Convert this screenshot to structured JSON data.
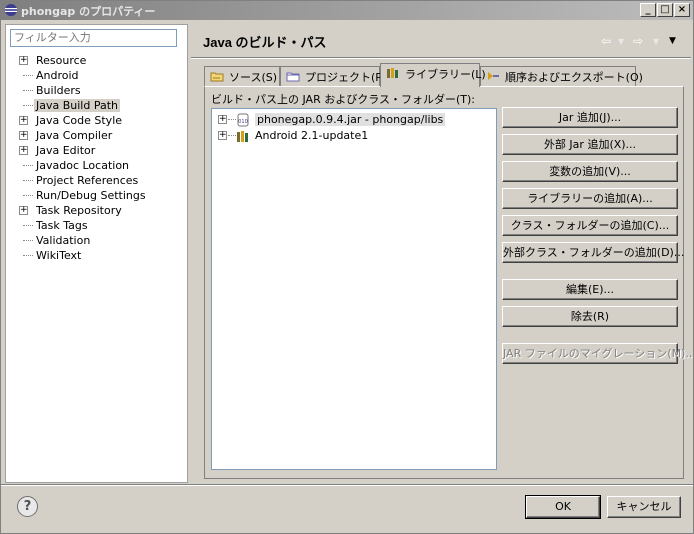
{
  "window": {
    "title": "phongap のプロパティー"
  },
  "filter": {
    "placeholder": "フィルター入力"
  },
  "tree": [
    {
      "label": "Resource",
      "expandable": true
    },
    {
      "label": "Android",
      "expandable": false
    },
    {
      "label": "Builders",
      "expandable": false
    },
    {
      "label": "Java Build Path",
      "expandable": false,
      "selected": true
    },
    {
      "label": "Java Code Style",
      "expandable": true
    },
    {
      "label": "Java Compiler",
      "expandable": true
    },
    {
      "label": "Java Editor",
      "expandable": true
    },
    {
      "label": "Javadoc Location",
      "expandable": false
    },
    {
      "label": "Project References",
      "expandable": false
    },
    {
      "label": "Run/Debug Settings",
      "expandable": false
    },
    {
      "label": "Task Repository",
      "expandable": true
    },
    {
      "label": "Task Tags",
      "expandable": false
    },
    {
      "label": "Validation",
      "expandable": false
    },
    {
      "label": "WikiText",
      "expandable": false
    }
  ],
  "page": {
    "title": "Java のビルド・パス"
  },
  "tabs": [
    {
      "label": "ソース(S)",
      "icon": "folder-source-icon"
    },
    {
      "label": "プロジェクト(P)",
      "icon": "folder-project-icon"
    },
    {
      "label": "ライブラリー(L)",
      "icon": "library-icon",
      "active": true
    },
    {
      "label": "順序およびエクスポート(O)",
      "icon": "order-export-icon"
    }
  ],
  "panel": {
    "label": "ビルド・パス上の JAR およびクラス・フォルダー(T):"
  },
  "jars": [
    {
      "label": "phonegap.0.9.4.jar - phongap/libs",
      "icon": "jar-icon"
    },
    {
      "label": "Android 2.1-update1",
      "icon": "library-icon"
    }
  ],
  "buttons": {
    "add_jar": "Jar 追加(J)...",
    "add_external_jar": "外部 Jar 追加(X)...",
    "add_variable": "変数の追加(V)...",
    "add_library": "ライブラリーの追加(A)...",
    "add_class_folder": "クラス・フォルダーの追加(C)...",
    "add_external_class_folder": "外部クラス・フォルダーの追加(D)...",
    "edit": "編集(E)...",
    "remove": "除去(R)",
    "migrate_jar": "JAR ファイルのマイグレーション(M)..."
  },
  "footer": {
    "help": "?",
    "ok": "OK",
    "cancel": "キャンセル"
  }
}
